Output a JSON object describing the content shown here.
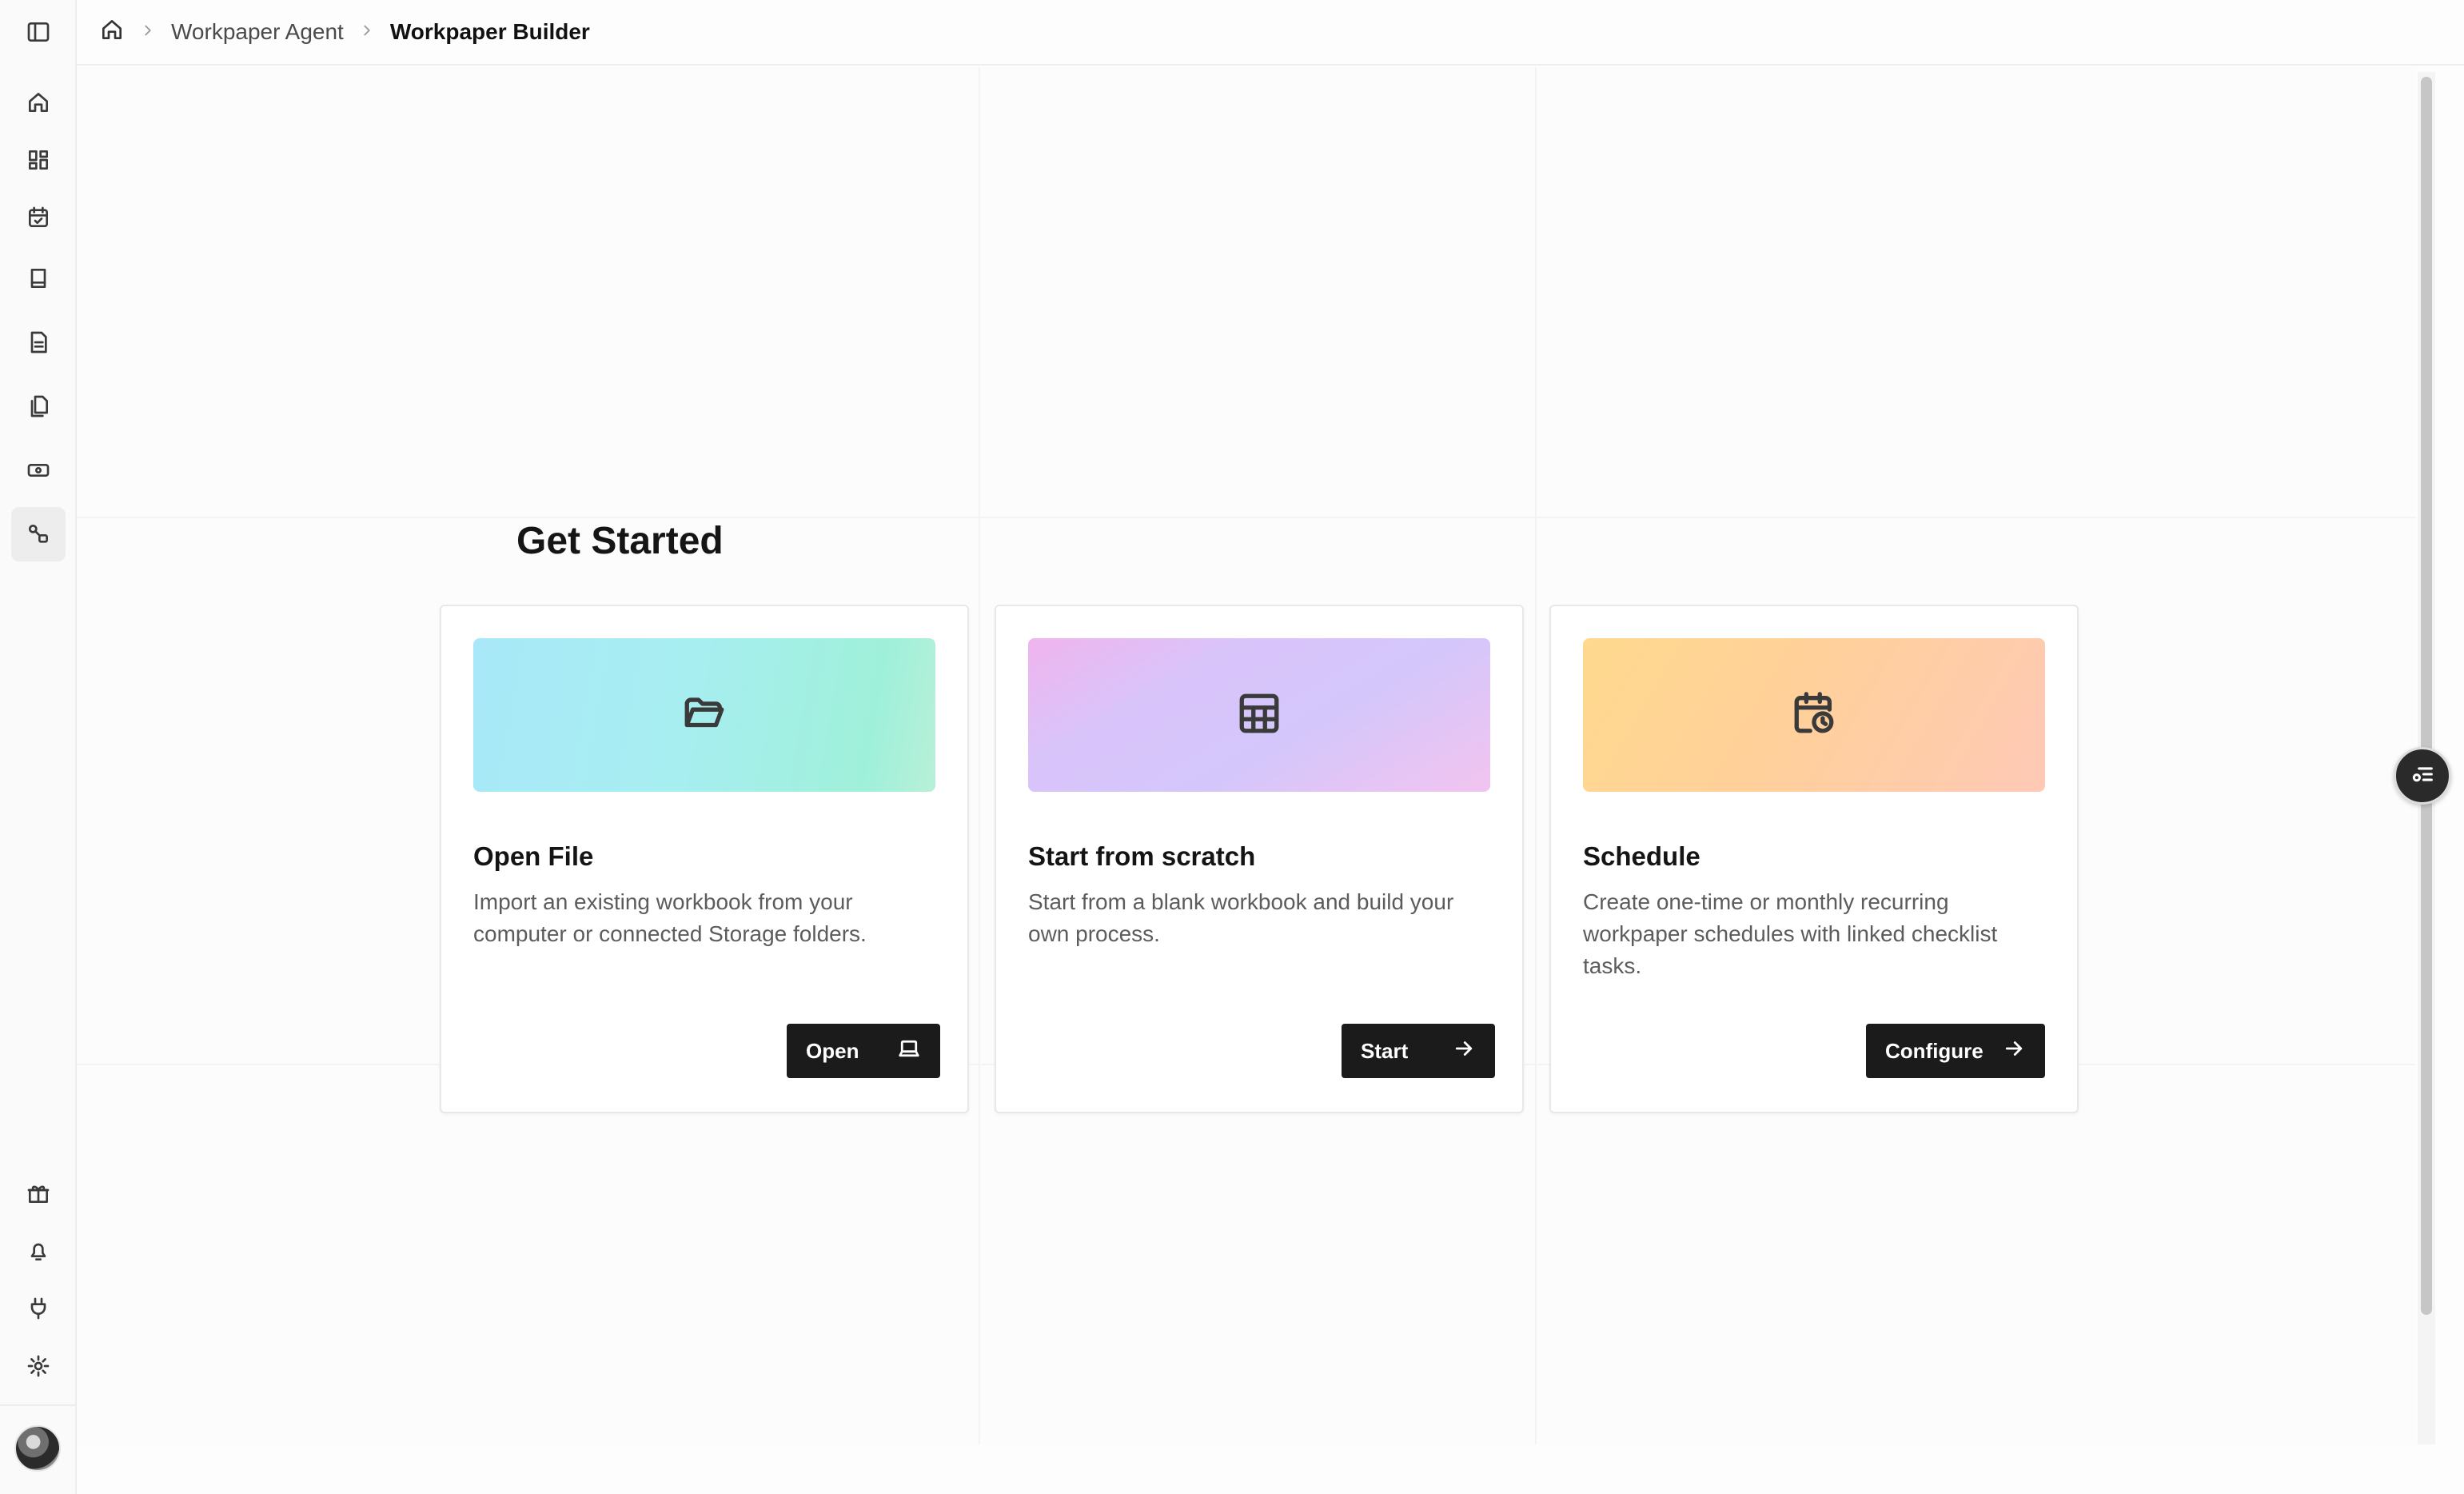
{
  "breadcrumb": {
    "items": [
      "Workpaper Agent",
      "Workpaper Builder"
    ]
  },
  "sidebar": {
    "top_icons": [
      "sidebar-toggle-icon",
      "home-icon",
      "dashboard-icon",
      "calendar-check-icon",
      "book-icon",
      "document-icon",
      "files-icon",
      "money-icon",
      "workflow-icon"
    ],
    "bottom_icons": [
      "gift-icon",
      "bell-icon",
      "plug-icon",
      "settings-icon"
    ],
    "active": "workflow-icon"
  },
  "main": {
    "title": "Get Started",
    "cards": [
      {
        "title": "Open File",
        "description": "Import an existing workbook from your computer or connected Storage folders.",
        "button": "Open",
        "icon": "folder-open-icon",
        "button_icon": "laptop-icon"
      },
      {
        "title": "Start from scratch",
        "description": "Start from a blank workbook and build your own process.",
        "button": "Start",
        "icon": "table-icon",
        "button_icon": "arrow-right-icon"
      },
      {
        "title": "Schedule",
        "description": "Create one-time or monthly recurring workpaper schedules with linked checklist tasks.",
        "button": "Configure",
        "icon": "calendar-clock-icon",
        "button_icon": "arrow-right-icon"
      }
    ]
  },
  "colors": {
    "button_bg": "#1b1b1b",
    "open_banner": "#a7eef1",
    "start_banner": "#d9c4fa",
    "schedule_banner": "#ffd09a"
  }
}
